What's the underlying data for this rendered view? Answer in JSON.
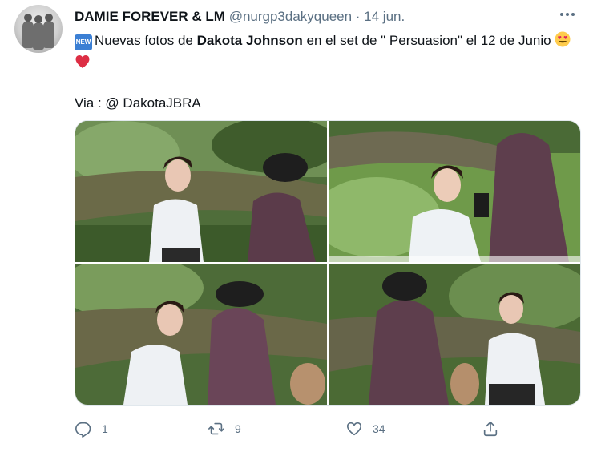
{
  "tweet": {
    "author": {
      "display_name": "DAMIE FOREVER & LM",
      "handle": "@nurgp3dakyqueen",
      "separator": " · ",
      "date": "14 jun."
    },
    "badge": "NEW",
    "text_before": "Nuevas  fotos de ",
    "text_bold": "Dakota Johnson",
    "text_after": " en el set  de \" Persuasion\" el 12 de Junio ",
    "emojis": [
      "heart-eyes-emoji",
      "red-heart-emoji"
    ],
    "via_line": "Via : @ DakotaJBRA",
    "photos": [
      "photo-1",
      "photo-2",
      "photo-3",
      "photo-4"
    ]
  },
  "actions": {
    "reply_count": "1",
    "retweet_count": "9",
    "like_count": "34"
  },
  "colors": {
    "text": "#0f1419",
    "secondary": "#5b7083",
    "badge": "#3b7fd4"
  }
}
